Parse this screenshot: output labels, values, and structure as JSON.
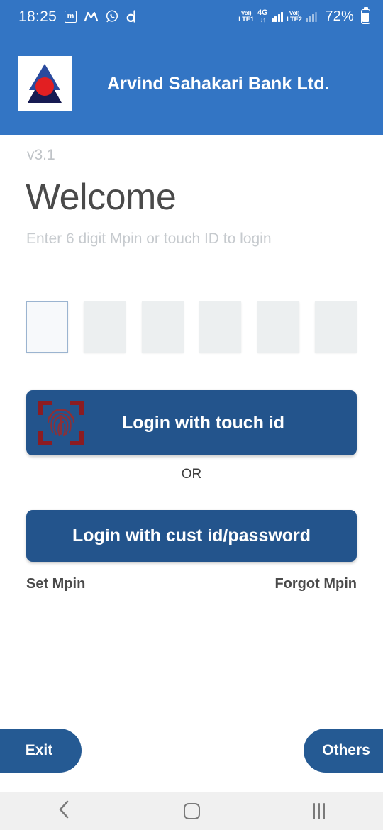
{
  "status_bar": {
    "clock": "18:25",
    "icons": [
      "boxed-m-icon",
      "gmail-m-icon",
      "whatsapp-icon",
      "letter-d-icon"
    ],
    "sim1_volte_top": "Vol)",
    "sim1_volte_bottom": "LTE1",
    "network_type": "4G",
    "network_sub": "↓↑",
    "sim2_volte_top": "Vol)",
    "sim2_volte_bottom": "LTE2",
    "battery_percent": "72%"
  },
  "header": {
    "bank_name": "Arvind Sahakari Bank Ltd.",
    "logo_name": "arvind-sahakari-bank-logo",
    "background_color": "#3375c4"
  },
  "main": {
    "version": "v3.1",
    "welcome_title": "Welcome",
    "subtitle": "Enter 6 digit Mpin or touch ID to login",
    "pin": {
      "digit_count": 6,
      "values": [
        "",
        "",
        "",
        "",
        "",
        ""
      ],
      "focused_index": 0
    },
    "touch_button": {
      "label": "Login with touch id",
      "icon": "fingerprint-scan-icon",
      "color": "#23548c"
    },
    "divider_label": "OR",
    "password_button": {
      "label": "Login with cust id/password",
      "color": "#23548c"
    },
    "links": {
      "set_mpin": "Set Mpin",
      "forgot_mpin": "Forgot Mpin"
    }
  },
  "footer": {
    "exit_label": "Exit",
    "others_label": "Others",
    "button_color": "#255a93"
  },
  "nav_bar": {
    "back": "back-chevron-icon",
    "home": "home-square-icon",
    "recents": "recents-bars-icon"
  }
}
